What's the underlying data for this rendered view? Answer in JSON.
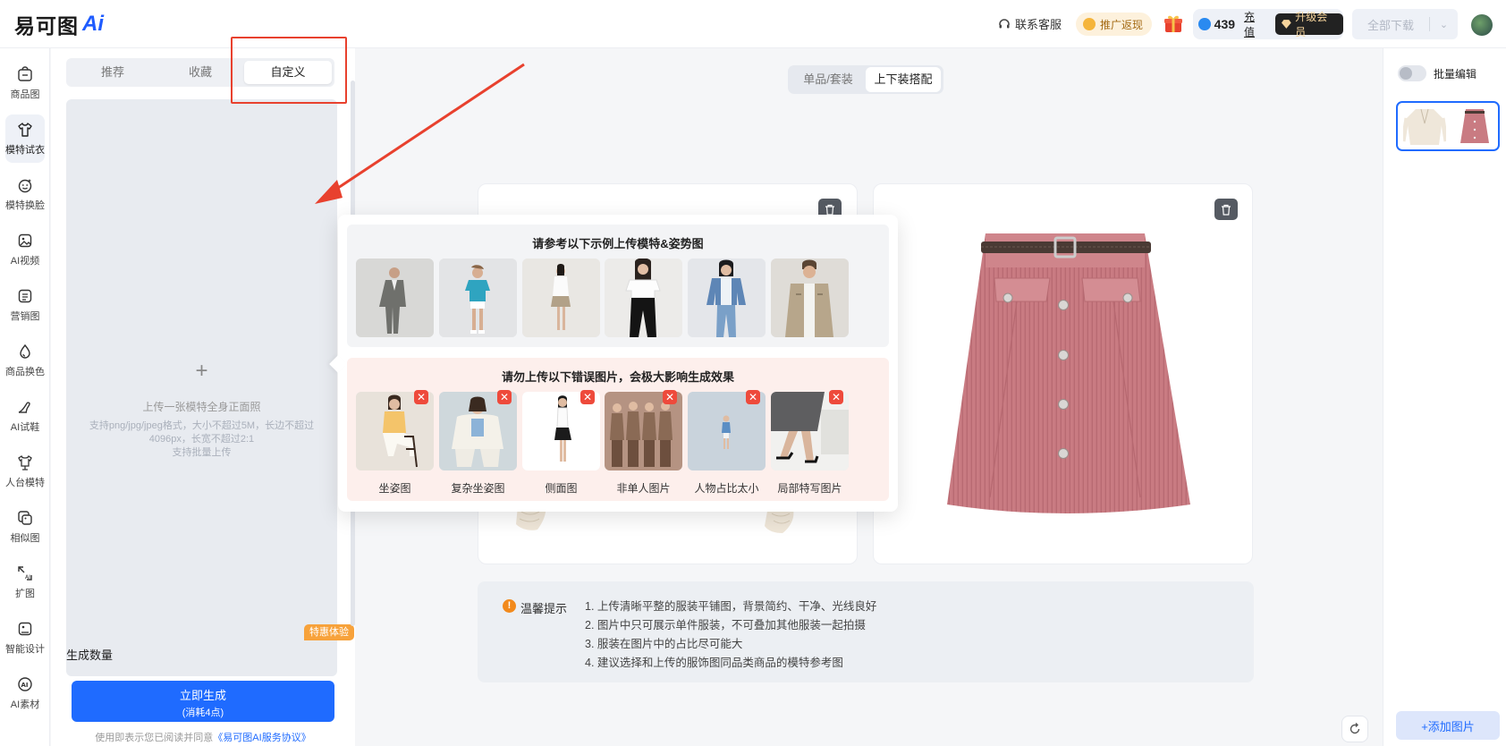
{
  "header": {
    "logo_text": "易可图",
    "logo_ai": "Ai",
    "contact_label": "联系客服",
    "promo_label": "推广返现",
    "points": "439",
    "recharge_label": "充值",
    "vip_label": "升级会员",
    "download_label": "全部下载"
  },
  "nav": {
    "items": [
      {
        "label": "商品图",
        "icon": "product-image-icon"
      },
      {
        "label": "模特试衣",
        "icon": "tshirt-icon",
        "active": true
      },
      {
        "label": "模特换脸",
        "icon": "face-icon"
      },
      {
        "label": "AI视频",
        "icon": "video-icon"
      },
      {
        "label": "营销图",
        "icon": "marketing-icon"
      },
      {
        "label": "商品换色",
        "icon": "color-drop-icon"
      },
      {
        "label": "AI试鞋",
        "icon": "shoe-icon"
      },
      {
        "label": "人台模特",
        "icon": "mannequin-icon"
      },
      {
        "label": "相似图",
        "icon": "similar-image-icon"
      },
      {
        "label": "扩图",
        "icon": "expand-icon"
      },
      {
        "label": "智能设计",
        "icon": "smart-design-icon"
      },
      {
        "label": "AI素材",
        "icon": "ai-material-icon"
      }
    ]
  },
  "panel": {
    "tabs": [
      "推荐",
      "收藏",
      "自定义"
    ],
    "active_tab": "自定义",
    "upload_plus": "+",
    "upload_title": "上传一张模特全身正面照",
    "upload_hint": "支持png/jpg/jpeg格式，大小不超过5M，长边不超过4096px，长宽不超过2:1",
    "upload_hint2": "支持批量上传",
    "gen_count_label": "生成数量",
    "gen_button_label": "立即生成",
    "gen_button_sub": "(消耗4点)",
    "gen_badge": "特惠体验",
    "agreement_prefix": "使用即表示您已阅读并同意",
    "agreement_link": "《易可图AI服务协议》"
  },
  "canvas": {
    "modes": [
      "单品/套装",
      "上下装搭配"
    ],
    "active_mode": "上下装搭配"
  },
  "popover": {
    "good_title": "请参考以下示例上传模特&姿势图",
    "bad_title": "请勿上传以下错误图片，会极大影响生成效果",
    "bad_labels": [
      "坐姿图",
      "复杂坐姿图",
      "侧面图",
      "非单人图片",
      "人物占比太小",
      "局部特写图片"
    ]
  },
  "tips": {
    "title": "温馨提示",
    "items": [
      "1. 上传清晰平整的服装平铺图，背景简约、干净、光线良好",
      "2. 图片中只可展示单件服装，不可叠加其他服装一起拍摄",
      "3. 服装在图片中的占比尽可能大",
      "4. 建议选择和上传的服饰图同品类商品的模特参考图"
    ]
  },
  "right": {
    "batch_edit_label": "批量编辑",
    "add_image_label": "+添加图片"
  },
  "colors": {
    "accent": "#1f6bff",
    "annotation": "#e8412e",
    "skirt": "#c97b82"
  }
}
